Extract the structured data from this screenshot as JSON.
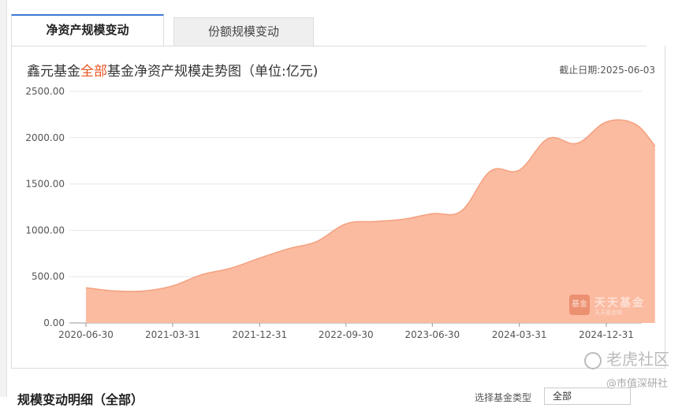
{
  "tabs": [
    {
      "label": "净资产规模变动",
      "active": true
    },
    {
      "label": "份额规模变动",
      "active": false
    }
  ],
  "chart_title": {
    "prefix": "鑫元基金",
    "highlight": "全部",
    "suffix": "基金净资产规模走势图（单位:亿元)"
  },
  "deadline": "截止日期:2025-06-03",
  "colors": {
    "area_fill": "#fbbba1",
    "area_line": "#f4a07e",
    "highlight": "#e8541f",
    "tab_accent": "#3a79d6"
  },
  "chart_data": {
    "type": "area",
    "title": "鑫元基金全部基金净资产规模走势图（单位:亿元)",
    "xlabel": "",
    "ylabel": "",
    "ylim": [
      0,
      2500
    ],
    "yticks": [
      "0.00",
      "500.00",
      "1000.00",
      "1500.00",
      "2000.00",
      "2500.00"
    ],
    "xticks": [
      "2020-06-30",
      "2021-03-31",
      "2021-12-31",
      "2022-09-30",
      "2023-06-30",
      "2024-03-31",
      "2024-12-31"
    ],
    "grid": true,
    "x": [
      "2020-06-30",
      "2020-09-30",
      "2020-12-31",
      "2021-03-31",
      "2021-06-30",
      "2021-09-30",
      "2021-12-31",
      "2022-03-31",
      "2022-06-30",
      "2022-09-30",
      "2022-12-31",
      "2023-03-31",
      "2023-06-30",
      "2023-09-30",
      "2023-12-31",
      "2024-03-31",
      "2024-06-30",
      "2024-09-30",
      "2024-12-31",
      "2025-03-31",
      "2025-06-03"
    ],
    "values": [
      380,
      345,
      345,
      400,
      520,
      590,
      700,
      800,
      880,
      1070,
      1095,
      1120,
      1180,
      1210,
      1640,
      1650,
      1990,
      1940,
      2170,
      2150,
      1910
    ]
  },
  "watermark": {
    "logo": "基金",
    "text": "天天基金",
    "sub": "天天基金网"
  },
  "corner_watermark": "老虎社区",
  "corner_watermark2": "@市值深研社",
  "bottom": {
    "heading": "规模变动明细（全部）",
    "filter_label": "选择基金类型",
    "select_value": "全部"
  }
}
